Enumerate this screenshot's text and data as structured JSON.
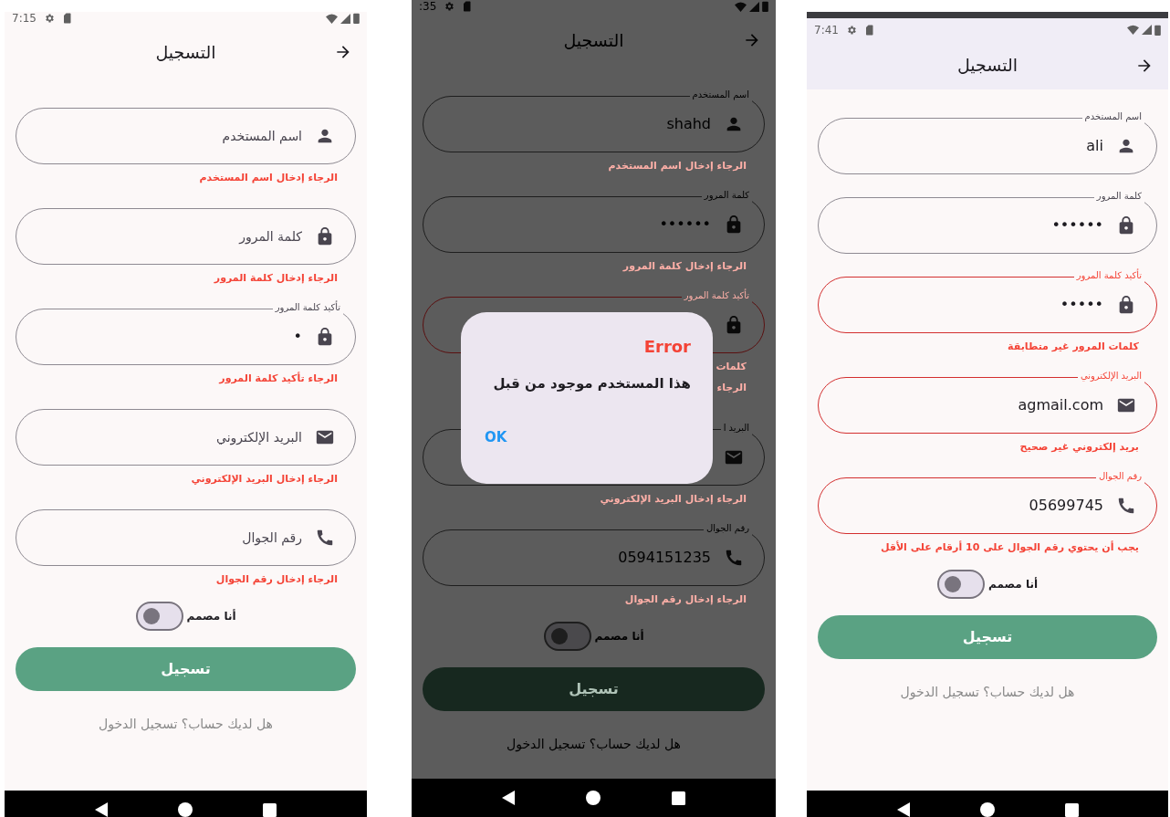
{
  "phones": [
    {
      "status_bar": {
        "time": "7:41"
      },
      "dimmed": false,
      "appbar_tinted": true,
      "title": "التسجيل",
      "fields": [
        {
          "kind": "user",
          "label": "اسم المستخدم",
          "filled": true,
          "value": "ali",
          "invalid": false
        },
        {
          "kind": "password",
          "label": "كلمة المرور",
          "filled": true,
          "value": "••••••",
          "invalid": false
        },
        {
          "kind": "password",
          "label": "تأكيد كلمة المرور",
          "filled": true,
          "value": "•••••",
          "invalid": true,
          "errors": [
            "كلمات المرور غير متطابقة"
          ]
        },
        {
          "kind": "email",
          "label": "البريد الإلكتروني",
          "filled": true,
          "value": "agmail.com",
          "invalid": true,
          "errors": [
            "بريد إلكتروني غير صحيح"
          ]
        },
        {
          "kind": "phone",
          "label": "رقم الجوال",
          "filled": true,
          "value": "05699745",
          "invalid": true,
          "errors": [
            "يجب أن يحتوي رقم الجوال على 10 أرقام على الأقل"
          ]
        }
      ],
      "designer_switch": {
        "label": "أنا مصمم",
        "on": false
      },
      "submit_button": "تسجيل",
      "login_link": "هل لديك حساب؟ تسجيل الدخول"
    },
    {
      "status_bar": {
        "time": ":35"
      },
      "dimmed": true,
      "appbar_tinted": false,
      "title": "التسجيل",
      "fields": [
        {
          "kind": "user",
          "label": "اسم المستخدم",
          "filled": true,
          "value": "shahd",
          "invalid": false,
          "errors": [
            "الرجاء إدخال اسم المستخدم"
          ]
        },
        {
          "kind": "password",
          "label": "كلمة المرور",
          "filled": true,
          "value": "••••••",
          "invalid": false,
          "errors": [
            "الرجاء إدخال كلمة المرور"
          ]
        },
        {
          "kind": "password",
          "label": "تأكيد كلمة المرور",
          "filled": true,
          "invalid": true,
          "errors": [
            "كلمات",
            "الرجاء"
          ]
        },
        {
          "kind": "email",
          "label": "البريد ا",
          "filled": true,
          "invalid": false,
          "errors": [
            "الرجاء إدخال البريد الإلكتروني"
          ]
        },
        {
          "kind": "phone",
          "label": "رقم الجوال",
          "filled": true,
          "value": "0594151235",
          "invalid": false,
          "errors": [
            "الرجاء إدخال رقم الجوال"
          ]
        }
      ],
      "designer_switch": {
        "label": "أنا مصمم",
        "on": false
      },
      "submit_button": "تسجيل",
      "login_link": "هل لديك حساب؟ تسجيل الدخول",
      "dialog": {
        "title": "Error",
        "message": "هذا المستخدم موجود من قبل",
        "button": "OK"
      }
    },
    {
      "status_bar": {
        "time": "7:15"
      },
      "dimmed": false,
      "appbar_tinted": false,
      "title": "التسجيل",
      "fields": [
        {
          "kind": "user",
          "label": "اسم المستخدم",
          "filled": false,
          "invalid": false,
          "errors": [
            "الرجاء إدخال اسم المستخدم"
          ]
        },
        {
          "kind": "password",
          "label": "كلمة المرور",
          "filled": false,
          "invalid": false,
          "errors": [
            "الرجاء إدخال كلمة المرور"
          ]
        },
        {
          "kind": "password",
          "label": "تأكيد كلمة المرور",
          "filled": true,
          "value": "•",
          "invalid": false,
          "errors": [
            "الرجاء تأكيد كلمة المرور"
          ]
        },
        {
          "kind": "email",
          "label": "البريد الإلكتروني",
          "filled": false,
          "invalid": false,
          "errors": [
            "الرجاء إدخال البريد الإلكتروني"
          ]
        },
        {
          "kind": "phone",
          "label": "رقم الجوال",
          "filled": false,
          "invalid": false,
          "errors": [
            "الرجاء إدخال رقم الجوال"
          ]
        }
      ],
      "designer_switch": {
        "label": "أنا مصمم",
        "on": false
      },
      "submit_button": "تسجيل",
      "login_link": "هل لديك حساب؟ تسجيل الدخول"
    }
  ]
}
